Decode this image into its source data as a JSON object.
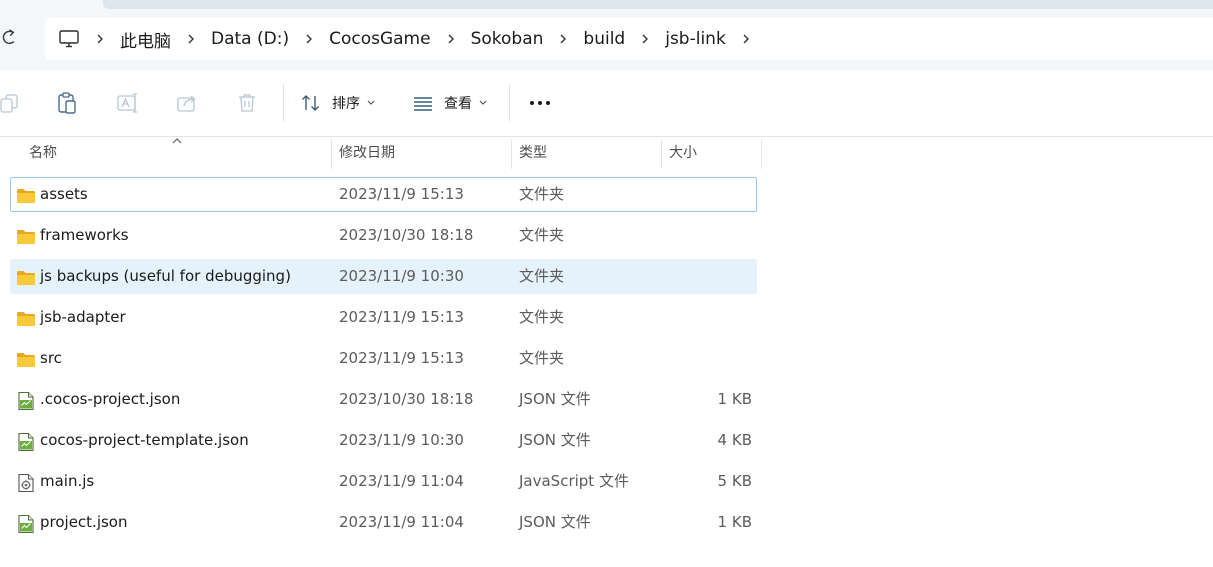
{
  "breadcrumb": {
    "items": [
      {
        "label": "此电脑",
        "icon": "monitor-icon"
      },
      {
        "label": "Data (D:)"
      },
      {
        "label": "CocosGame"
      },
      {
        "label": "Sokoban"
      },
      {
        "label": "build"
      },
      {
        "label": "jsb-link"
      }
    ]
  },
  "toolbar": {
    "copy_icon": "copy-icon",
    "paste_icon": "paste-icon",
    "rename_icon": "rename-icon",
    "share_icon": "share-icon",
    "delete_icon": "delete-icon",
    "sort_label": "排序",
    "view_label": "查看",
    "more_label": "···"
  },
  "columns": {
    "name": "名称",
    "date": "修改日期",
    "type": "类型",
    "size": "大小"
  },
  "files": [
    {
      "name": "assets",
      "date": "2023/11/9 15:13",
      "type": "文件夹",
      "size": "",
      "icon": "folder-icon"
    },
    {
      "name": "frameworks",
      "date": "2023/10/30 18:18",
      "type": "文件夹",
      "size": "",
      "icon": "folder-icon"
    },
    {
      "name": "js backups (useful for debugging)",
      "date": "2023/11/9 10:30",
      "type": "文件夹",
      "size": "",
      "icon": "folder-icon"
    },
    {
      "name": "jsb-adapter",
      "date": "2023/11/9 15:13",
      "type": "文件夹",
      "size": "",
      "icon": "folder-icon"
    },
    {
      "name": "src",
      "date": "2023/11/9 15:13",
      "type": "文件夹",
      "size": "",
      "icon": "folder-icon"
    },
    {
      "name": ".cocos-project.json",
      "date": "2023/10/30 18:18",
      "type": "JSON 文件",
      "size": "1 KB",
      "icon": "json-file-icon"
    },
    {
      "name": "cocos-project-template.json",
      "date": "2023/11/9 10:30",
      "type": "JSON 文件",
      "size": "4 KB",
      "icon": "json-file-icon"
    },
    {
      "name": "main.js",
      "date": "2023/11/9 11:04",
      "type": "JavaScript 文件",
      "size": "5 KB",
      "icon": "script-file-icon"
    },
    {
      "name": "project.json",
      "date": "2023/11/9 11:04",
      "type": "JSON 文件",
      "size": "1 KB",
      "icon": "json-file-icon"
    }
  ],
  "colors": {
    "accent": "#0067c0",
    "selection_border": "#99c9ef",
    "hover_background": "#e5f1fb",
    "folder_yellow": "#f8c93a"
  }
}
